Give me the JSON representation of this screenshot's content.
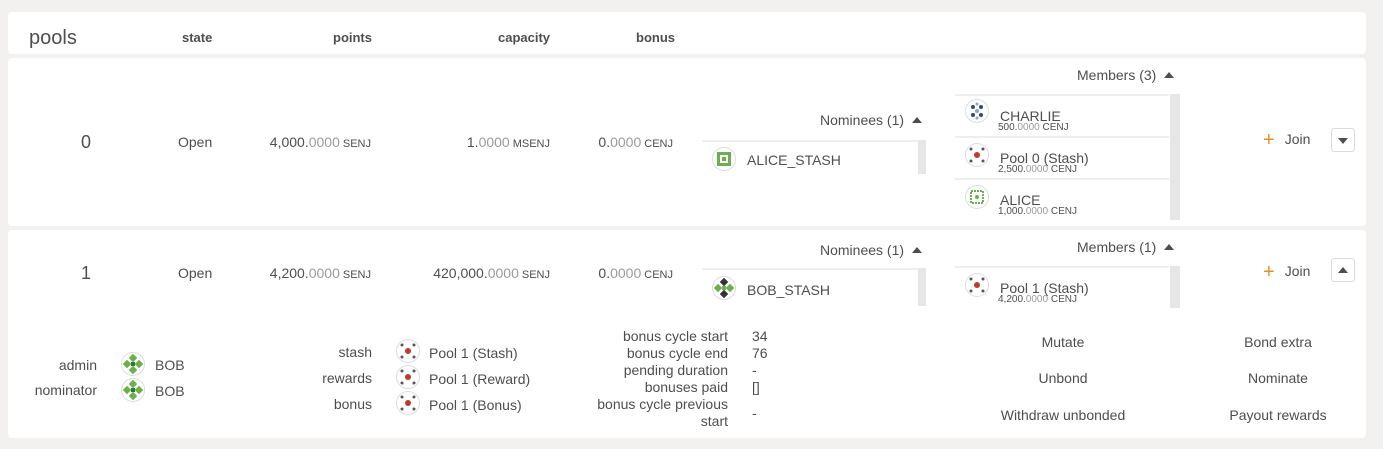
{
  "header": {
    "title": "pools",
    "columns": {
      "state": "state",
      "points": "points",
      "capacity": "capacity",
      "bonus": "bonus"
    }
  },
  "pools": [
    {
      "id": "0",
      "state": "Open",
      "points": {
        "int": "4,000.",
        "dec": "0000",
        "unit": "SENJ"
      },
      "capacity": {
        "int": "1.",
        "dec": "0000",
        "unit": "MSENJ"
      },
      "bonus": {
        "int": "0.",
        "dec": "0000",
        "unit": "CENJ"
      },
      "nominees_title": "Nominees (1)",
      "nominees": [
        {
          "name": "ALICE_STASH"
        }
      ],
      "members_title": "Members (3)",
      "members": [
        {
          "name": "CHARLIE",
          "bal_int": "500.",
          "bal_dec": "0000",
          "bal_unit": "CENJ"
        },
        {
          "name": "Pool 0 (Stash)",
          "bal_int": "2,500.",
          "bal_dec": "0000",
          "bal_unit": "CENJ"
        },
        {
          "name": "ALICE",
          "bal_int": "1,000.",
          "bal_dec": "0000",
          "bal_unit": "CENJ"
        }
      ],
      "join_label": "Join"
    },
    {
      "id": "1",
      "state": "Open",
      "points": {
        "int": "4,200.",
        "dec": "0000",
        "unit": "SENJ"
      },
      "capacity": {
        "int": "420,000.",
        "dec": "0000",
        "unit": "SENJ"
      },
      "bonus": {
        "int": "0.",
        "dec": "0000",
        "unit": "CENJ"
      },
      "nominees_title": "Nominees (1)",
      "nominees": [
        {
          "name": "BOB_STASH"
        }
      ],
      "members_title": "Members (1)",
      "members": [
        {
          "name": "Pool 1 (Stash)",
          "bal_int": "4,200.",
          "bal_dec": "0000",
          "bal_unit": "CENJ"
        }
      ],
      "join_label": "Join"
    }
  ],
  "details": {
    "roles": [
      {
        "label": "admin",
        "name": "BOB"
      },
      {
        "label": "nominator",
        "name": "BOB"
      }
    ],
    "accounts": [
      {
        "label": "stash",
        "name": "Pool 1 (Stash)"
      },
      {
        "label": "rewards",
        "name": "Pool 1 (Reward)"
      },
      {
        "label": "bonus",
        "name": "Pool 1 (Bonus)"
      }
    ],
    "bonus_info": [
      {
        "label": "bonus cycle start",
        "value": "34"
      },
      {
        "label": "bonus cycle end",
        "value": "76"
      },
      {
        "label": "pending duration",
        "value": "-"
      },
      {
        "label": "bonuses paid",
        "value": "[]"
      },
      {
        "label_line1": "bonus cycle previous",
        "label_line2": "start",
        "value": "-"
      }
    ],
    "actions": {
      "mutate": "Mutate",
      "bond_extra": "Bond extra",
      "unbond": "Unbond",
      "nominate": "Nominate",
      "withdraw_unbonded": "Withdraw unbonded",
      "payout_rewards": "Payout rewards"
    }
  },
  "colors": {
    "accent": "#e88c30",
    "text": "#4e4e4e",
    "muted": "#9b9b9b",
    "background": "#f2f1f0"
  }
}
